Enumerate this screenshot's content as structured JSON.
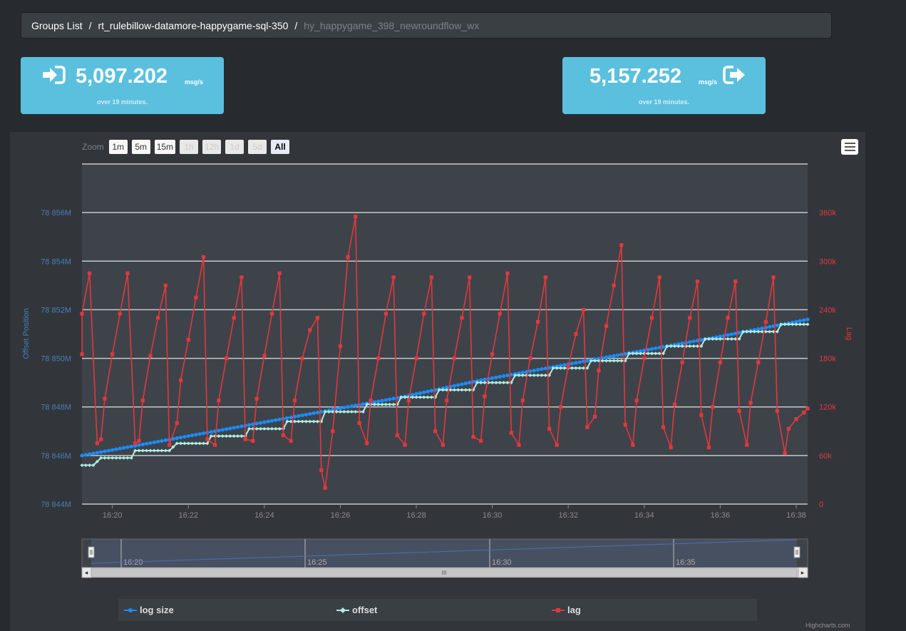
{
  "breadcrumb": {
    "groups_list": "Groups List",
    "separator": "/",
    "group": "rt_rulebillow-datamore-happygame-sql-350",
    "topic": "hy_happygame_398_newroundflow_wx"
  },
  "stats": {
    "incoming": {
      "value": "5,097.202",
      "unit": "msg/s",
      "period": "over 19 minutes.",
      "icon": "sign-in-icon"
    },
    "outgoing": {
      "value": "5,157.252",
      "unit": "msg/s",
      "period": "over 19 minutes.",
      "icon": "sign-out-icon"
    }
  },
  "zoom": {
    "label": "Zoom",
    "buttons": [
      {
        "label": "1m",
        "state": "enabled"
      },
      {
        "label": "5m",
        "state": "enabled"
      },
      {
        "label": "15m",
        "state": "enabled"
      },
      {
        "label": "1h",
        "state": "disabled"
      },
      {
        "label": "12h",
        "state": "disabled"
      },
      {
        "label": "1d",
        "state": "disabled"
      },
      {
        "label": "5d",
        "state": "disabled"
      },
      {
        "label": "All",
        "state": "active"
      }
    ]
  },
  "colors": {
    "log_size": "#1a8cff",
    "offset": "#aeeee0",
    "lag": "#e0383d",
    "left_axis": "#4a7cb8",
    "right_axis": "#e0383d"
  },
  "chart_data": {
    "type": "line",
    "x_unit": "minutes past 16:00",
    "x_range": [
      19.2,
      38.3
    ],
    "y_left": {
      "label": "Offset Position",
      "ticks": [
        "78 844M",
        "78 846M",
        "78 848M",
        "78 850M",
        "78 852M",
        "78 854M",
        "78 856M"
      ],
      "range": [
        78844,
        78858
      ]
    },
    "y_right": {
      "label": "Lag",
      "ticks": [
        "0",
        "60k",
        "120k",
        "180k",
        "240k",
        "300k",
        "360k"
      ],
      "range": [
        0,
        420
      ]
    },
    "x_ticks": [
      "16:20",
      "16:22",
      "16:24",
      "16:26",
      "16:28",
      "16:30",
      "16:32",
      "16:34",
      "16:36",
      "16:38"
    ],
    "series": [
      {
        "name": "log size",
        "axis": "left",
        "x": [
          19.2,
          21.3,
          23.4,
          25.5,
          27.6,
          29.7,
          31.8,
          33.9,
          36.0,
          38.3
        ],
        "y": [
          78846.0,
          78846.6,
          78847.2,
          78847.8,
          78848.4,
          78849.1,
          78849.7,
          78850.3,
          78850.9,
          78851.6
        ]
      },
      {
        "name": "offset",
        "axis": "left",
        "x": [
          19.2,
          19.5,
          19.7,
          20.0,
          20.1,
          20.5,
          20.6,
          21.5,
          21.7,
          22.5,
          22.6,
          23.5,
          23.6,
          24.5,
          24.6,
          25.5,
          25.6,
          26.6,
          26.7,
          27.5,
          27.6,
          28.5,
          28.6,
          29.5,
          29.6,
          30.5,
          30.6,
          31.5,
          31.6,
          32.5,
          32.6,
          33.5,
          33.6,
          34.5,
          34.6,
          35.5,
          35.6,
          36.5,
          36.6,
          37.5,
          37.6,
          38.3
        ],
        "y": [
          78845.6,
          78845.6,
          78845.9,
          78845.9,
          78845.9,
          78845.9,
          78846.2,
          78846.2,
          78846.5,
          78846.5,
          78846.8,
          78846.8,
          78847.1,
          78847.1,
          78847.4,
          78847.4,
          78847.8,
          78847.8,
          78848.1,
          78848.1,
          78848.4,
          78848.4,
          78848.7,
          78848.7,
          78849.0,
          78849.0,
          78849.3,
          78849.3,
          78849.6,
          78849.6,
          78849.9,
          78849.9,
          78850.2,
          78850.2,
          78850.5,
          78850.5,
          78850.8,
          78850.8,
          78851.1,
          78851.1,
          78851.4,
          78851.4
        ]
      },
      {
        "name": "lag",
        "axis": "right",
        "x": [
          19.0,
          19.1,
          19.4,
          19.6,
          19.7,
          19.8,
          20.0,
          20.2,
          20.4,
          20.6,
          20.7,
          20.8,
          21.0,
          21.2,
          21.4,
          21.5,
          21.7,
          21.8,
          22.0,
          22.2,
          22.4,
          22.5,
          22.7,
          22.8,
          23.0,
          23.2,
          23.4,
          23.5,
          23.7,
          23.8,
          24.0,
          24.2,
          24.4,
          24.5,
          24.7,
          24.8,
          25.0,
          25.2,
          25.4,
          25.5,
          25.6,
          25.8,
          26.0,
          26.2,
          26.4,
          26.5,
          26.7,
          26.8,
          27.0,
          27.2,
          27.4,
          27.5,
          27.7,
          27.8,
          28.0,
          28.2,
          28.4,
          28.5,
          28.7,
          28.8,
          29.0,
          29.2,
          29.4,
          29.5,
          29.7,
          29.8,
          30.0,
          30.2,
          30.4,
          30.5,
          30.7,
          30.8,
          31.0,
          31.2,
          31.4,
          31.5,
          31.7,
          31.8,
          32.0,
          32.2,
          32.4,
          32.5,
          32.7,
          32.8,
          33.0,
          33.2,
          33.4,
          33.5,
          33.7,
          33.8,
          34.0,
          34.2,
          34.4,
          34.5,
          34.7,
          34.8,
          35.0,
          35.2,
          35.4,
          35.5,
          35.7,
          35.8,
          36.0,
          36.2,
          36.4,
          36.5,
          36.7,
          36.8,
          37.0,
          37.2,
          37.4,
          37.5,
          37.7,
          37.8,
          38.0,
          38.2,
          38.3
        ],
        "y": [
          185,
          235,
          285,
          75,
          80,
          130,
          185,
          235,
          285,
          75,
          78,
          128,
          183,
          230,
          270,
          73,
          100,
          153,
          203,
          255,
          305,
          80,
          73,
          128,
          180,
          230,
          280,
          80,
          78,
          130,
          183,
          235,
          285,
          85,
          78,
          128,
          180,
          215,
          230,
          42,
          20,
          90,
          195,
          305,
          355,
          100,
          75,
          128,
          180,
          235,
          280,
          85,
          73,
          128,
          180,
          235,
          280,
          90,
          73,
          128,
          180,
          230,
          280,
          83,
          78,
          133,
          185,
          235,
          285,
          88,
          73,
          128,
          180,
          225,
          280,
          93,
          73,
          120,
          170,
          210,
          240,
          95,
          108,
          165,
          220,
          270,
          320,
          98,
          73,
          128,
          180,
          230,
          280,
          95,
          70,
          123,
          175,
          230,
          275,
          110,
          70,
          120,
          175,
          230,
          275,
          115,
          73,
          125,
          175,
          225,
          280,
          115,
          63,
          93,
          105,
          113,
          118
        ]
      }
    ]
  },
  "navigator": {
    "ticks": [
      "16:20",
      "16:25",
      "16:30",
      "16:35"
    ],
    "scroll_left": "◂",
    "scroll_right": "▸",
    "grip": "III"
  },
  "legend": {
    "items": [
      {
        "label": "log size",
        "color": "#1a8cff",
        "marker": "circle"
      },
      {
        "label": "offset",
        "color": "#aeeee0",
        "marker": "diamond"
      },
      {
        "label": "lag",
        "color": "#e0383d",
        "marker": "square"
      }
    ]
  },
  "credit": "Highcharts.com"
}
